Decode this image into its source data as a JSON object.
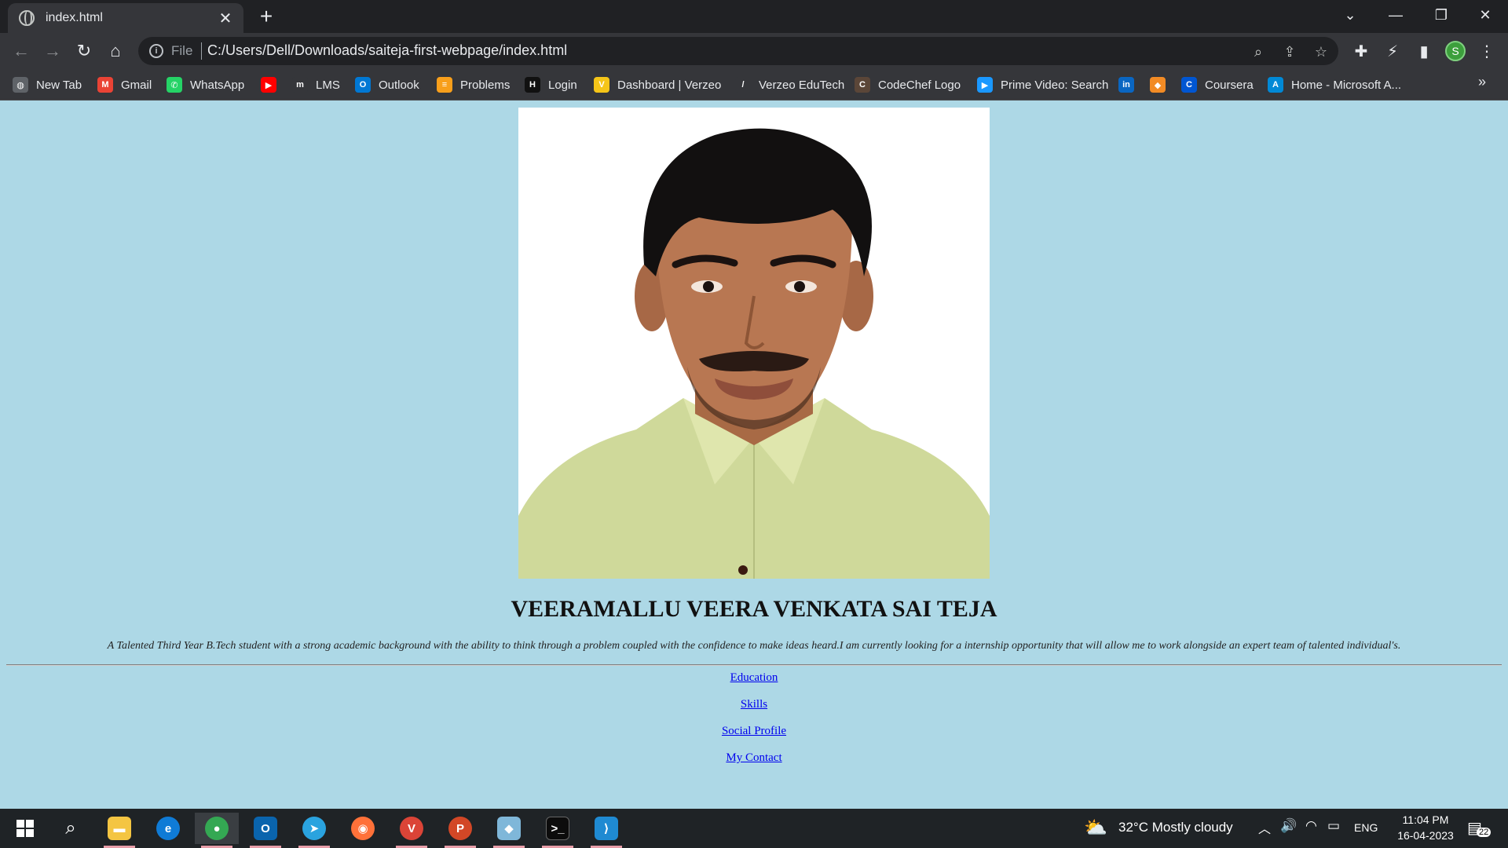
{
  "browser": {
    "tab_title": "index.html",
    "tab_close": "✕",
    "new_tab": "+",
    "url_scheme": "File",
    "url": "C:/Users/Dell/Downloads/saiteja-first-webpage/index.html",
    "profile_initial": "S"
  },
  "bookmarks": [
    {
      "label": "New Tab",
      "icon": "globe-icon",
      "color": "#5f6368"
    },
    {
      "label": "Gmail",
      "icon": "gmail-icon",
      "color": "#ea4335"
    },
    {
      "label": "WhatsApp",
      "icon": "whatsapp-icon",
      "color": "#25d366"
    },
    {
      "label": "",
      "icon": "youtube-icon",
      "color": "#ff0000"
    },
    {
      "label": "LMS",
      "icon": "lms-icon",
      "color": "#35363a"
    },
    {
      "label": "Outlook",
      "icon": "outlook-icon",
      "color": "#0078d4"
    },
    {
      "label": "Problems",
      "icon": "problems-icon",
      "color": "#f89f1b"
    },
    {
      "label": "Login",
      "icon": "login-icon",
      "color": "#111111"
    },
    {
      "label": "Dashboard | Verzeo",
      "icon": "verzeo-icon",
      "color": "#f5c518"
    },
    {
      "label": "Verzeo EduTech",
      "icon": "verzeo-edutech-icon",
      "color": "#35363a"
    },
    {
      "label": "CodeChef Logo",
      "icon": "codechef-icon",
      "color": "#5b4638"
    },
    {
      "label": "Prime Video: Search",
      "icon": "prime-video-icon",
      "color": "#1a98ff"
    },
    {
      "label": "",
      "icon": "linkedin-icon",
      "color": "#0a66c2"
    },
    {
      "label": "",
      "icon": "box-icon",
      "color": "#f28b25"
    },
    {
      "label": "Coursera",
      "icon": "coursera-icon",
      "color": "#0056d2"
    },
    {
      "label": "Home - Microsoft A...",
      "icon": "azure-icon",
      "color": "#0089d6"
    }
  ],
  "page": {
    "name": "VEERAMALLU VEERA VENKATA SAI TEJA",
    "bio": "A Talented Third Year B.Tech student with a strong academic background with the ability to think through a problem coupled with the confidence to make ideas heard.I am currently looking for a internship opportunity that will allow me to work alongside an expert team of talented individual's.",
    "links": [
      "Education",
      "Skills",
      "Social Profile",
      "My Contact"
    ]
  },
  "taskbar": {
    "weather": "32°C  Mostly cloudy",
    "language": "ENG",
    "time": "11:04 PM",
    "date": "16-04-2023",
    "notifications": "22"
  }
}
